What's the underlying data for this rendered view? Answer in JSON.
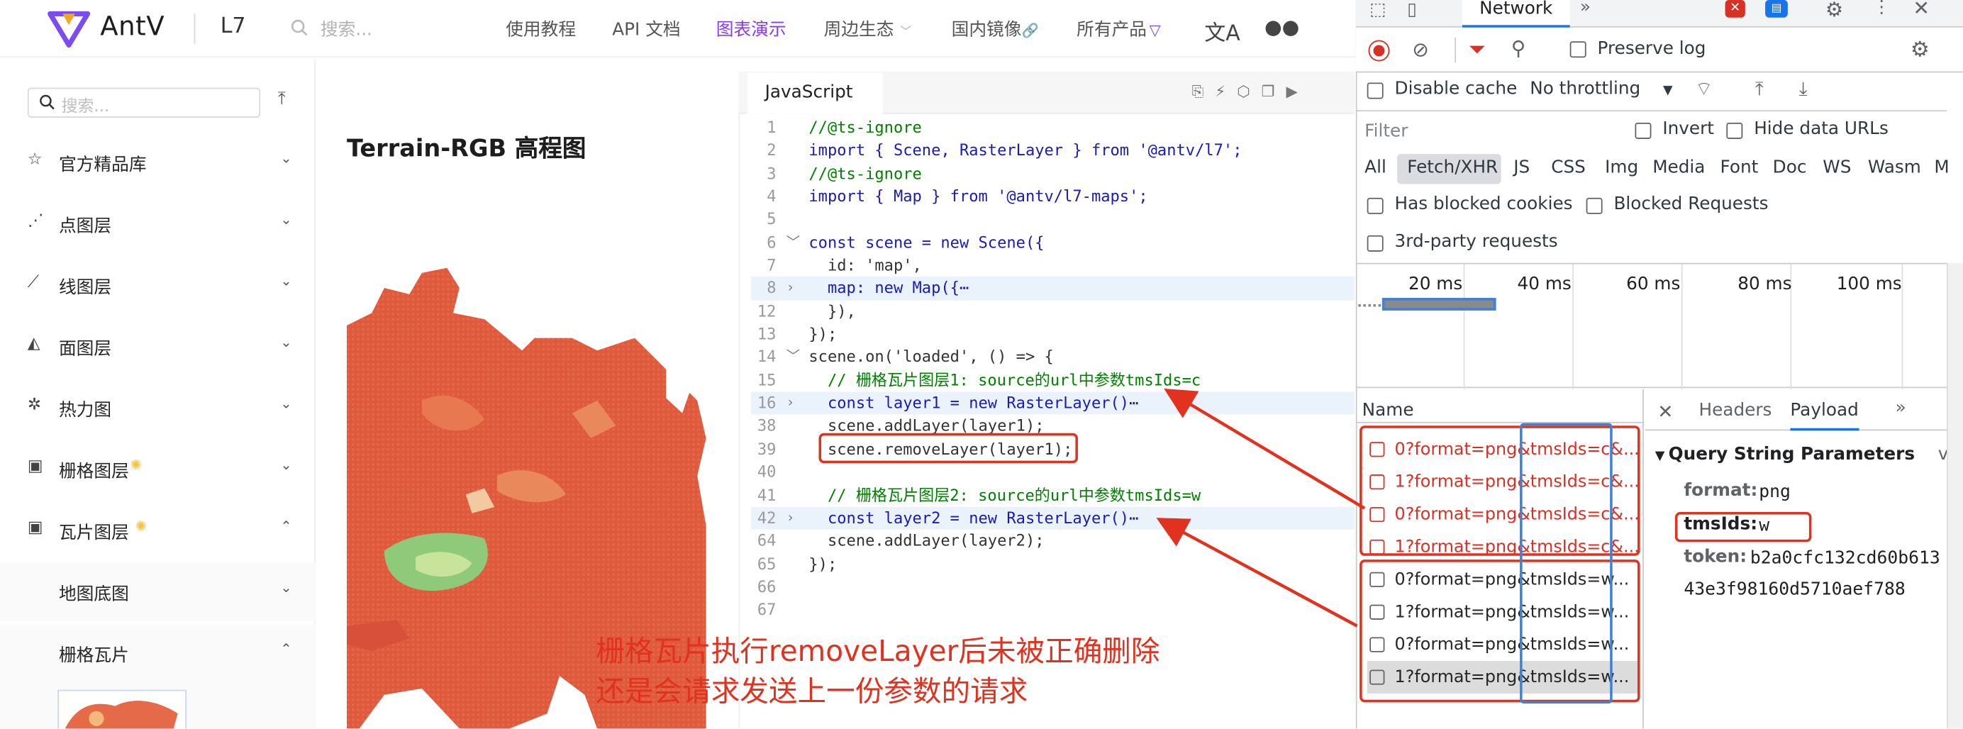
{
  "nav": {
    "brand": "AntV",
    "product": "L7",
    "search_placeholder": "搜索...",
    "items": [
      {
        "label": "使用教程"
      },
      {
        "label": "API 文档"
      },
      {
        "label": "图表演示",
        "active": true
      },
      {
        "label": "周边生态"
      },
      {
        "label": "国内镜像"
      },
      {
        "label": "所有产品"
      }
    ],
    "colors": {
      "active": "#873bf4"
    }
  },
  "sidebar": {
    "search_placeholder": "搜索...",
    "items": [
      {
        "label": "官方精品库",
        "icon": "star-icon",
        "expanded": false
      },
      {
        "label": "点图层",
        "icon": "scatter-icon",
        "expanded": false
      },
      {
        "label": "线图层",
        "icon": "line-chart-icon",
        "expanded": false
      },
      {
        "label": "面图层",
        "icon": "area-chart-icon",
        "expanded": false
      },
      {
        "label": "热力图",
        "icon": "heatmap-icon",
        "expanded": false
      },
      {
        "label": "栅格图层",
        "icon": "picture-icon",
        "expanded": false
      },
      {
        "label": "瓦片图层",
        "icon": "picture-icon",
        "expanded": true
      }
    ],
    "subitems": [
      {
        "label": "地图底图",
        "expanded": false
      },
      {
        "label": "栅格瓦片",
        "expanded": true
      }
    ]
  },
  "content": {
    "title": "Terrain-RGB 高程图"
  },
  "editor": {
    "tab": "JavaScript",
    "lines": [
      {
        "n": "1",
        "code": "//@ts-ignore"
      },
      {
        "n": "2",
        "code": "import { Scene, RasterLayer } from '@antv/l7';"
      },
      {
        "n": "3",
        "code": "//@ts-ignore"
      },
      {
        "n": "4",
        "code": "import { Map } from '@antv/l7-maps';"
      },
      {
        "n": "5",
        "code": ""
      },
      {
        "n": "6",
        "code": "const scene = new Scene({"
      },
      {
        "n": "7",
        "code": "  id: 'map',"
      },
      {
        "n": "8",
        "code": "  map: new Map({⋯"
      },
      {
        "n": "12",
        "code": "  }),"
      },
      {
        "n": "13",
        "code": "});"
      },
      {
        "n": "14",
        "code": "scene.on('loaded', () => {"
      },
      {
        "n": "15",
        "code": "  // 栅格瓦片图层1: source的url中参数tmsIds=c"
      },
      {
        "n": "16",
        "code": "  const layer1 = new RasterLayer()⋯"
      },
      {
        "n": "38",
        "code": "  scene.addLayer(layer1);"
      },
      {
        "n": "39",
        "code": "  scene.removeLayer(layer1);"
      },
      {
        "n": "40",
        "code": ""
      },
      {
        "n": "41",
        "code": "  // 栅格瓦片图层2: source的url中参数tmsIds=w"
      },
      {
        "n": "42",
        "code": "  const layer2 = new RasterLayer()⋯"
      },
      {
        "n": "64",
        "code": "  scene.addLayer(layer2);"
      },
      {
        "n": "65",
        "code": "});"
      },
      {
        "n": "66",
        "code": ""
      },
      {
        "n": "67",
        "code": ""
      }
    ]
  },
  "devtools": {
    "tab": "Network",
    "preserve_log": "Preserve log",
    "disable_cache": "Disable cache",
    "throttling": "No throttling",
    "filter_placeholder": "Filter",
    "invert": "Invert",
    "hide_data_urls": "Hide data URLs",
    "types": [
      "All",
      "Fetch/XHR",
      "JS",
      "CSS",
      "Img",
      "Media",
      "Font",
      "Doc",
      "WS",
      "Wasm",
      "M"
    ],
    "has_blocked_cookies": "Has blocked cookies",
    "blocked_requests": "Blocked Requests",
    "third_party": "3rd-party requests",
    "timeline_labels": [
      "20 ms",
      "40 ms",
      "60 ms",
      "80 ms",
      "100 ms"
    ],
    "name_header": "Name",
    "requests": [
      {
        "name": "0?format=png&tmsIds=c&...",
        "error": true
      },
      {
        "name": "1?format=png&tmsIds=c&...",
        "error": true
      },
      {
        "name": "0?format=png&tmsIds=c&...",
        "error": true
      },
      {
        "name": "1?format=png&tmsIds=c&...",
        "error": true
      },
      {
        "name": "0?format=png&tmsIds=w...",
        "error": false
      },
      {
        "name": "1?format=png&tmsIds=w...",
        "error": false
      },
      {
        "name": "0?format=png&tmsIds=w...",
        "error": false
      },
      {
        "name": "1?format=png&tmsIds=w...",
        "error": false,
        "selected": true
      }
    ],
    "detail_tabs": [
      "Headers",
      "Payload"
    ],
    "section_title": "Query String Parameters",
    "section_extra": "v",
    "params": {
      "format_key": "format:",
      "format_val": "png",
      "tmsids_key": "tmsIds:",
      "tmsids_val": "w",
      "token_key": "token:",
      "token_val": "b2a0cfc132cd60b613",
      "token_cont": "43e3f98160d5710aef788"
    },
    "colors": {
      "error": "#d93025",
      "accent": "#1a73e8"
    }
  },
  "annotation": {
    "line1": "栅格瓦片执行removeLayer后未被正确删除",
    "line2": "还是会请求发送上一份参数的请求",
    "color": "#e0321f"
  }
}
